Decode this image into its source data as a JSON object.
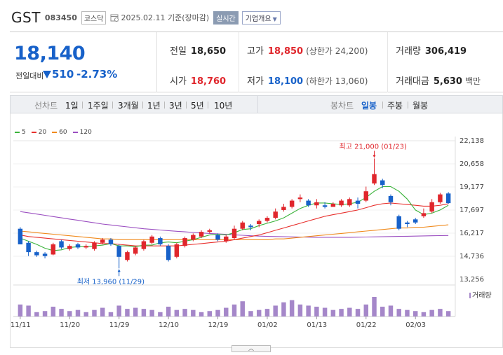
{
  "header": {
    "name": "GST",
    "code": "083450",
    "market": "코스닥",
    "date": "2025.02.11",
    "basis": "기준(장마감)",
    "realtime_label": "실시간",
    "company_label": "기업개요"
  },
  "summary": {
    "current_price": "18,140",
    "change_label": "전일대비",
    "change_value": "510",
    "change_rate": "-2.73%",
    "prev_close_label": "전일",
    "prev_close": "18,650",
    "open_label": "시가",
    "open": "18,760",
    "high_label": "고가",
    "high": "18,850",
    "upper_limit": "(상한가 24,200)",
    "low_label": "저가",
    "low": "18,100",
    "lower_limit": "(하한가 13,060)",
    "volume_label": "거래량",
    "volume": "306,419",
    "amount_label": "거래대금",
    "amount": "5,630",
    "amount_unit": "백만"
  },
  "periodbar": {
    "line_label": "선차트",
    "periods": [
      "1일",
      "1주일",
      "3개월",
      "1년",
      "3년",
      "5년",
      "10년"
    ],
    "candle_label": "봉차트",
    "candles": [
      "일봉",
      "주봉",
      "월봉"
    ],
    "active_candle": "일봉"
  },
  "colors": {
    "up": "#e0262c",
    "down": "#1761c9",
    "ma5": "#3bb33b",
    "ma20": "#e8302d",
    "ma60": "#f08a1c",
    "ma120": "#9b4fc1"
  },
  "chart_data": {
    "type": "candlestick",
    "legend": [
      {
        "name": "5",
        "color": "#3bb33b"
      },
      {
        "name": "20",
        "color": "#e8302d"
      },
      {
        "name": "60",
        "color": "#f08a1c"
      },
      {
        "name": "120",
        "color": "#9b4fc1"
      }
    ],
    "y_ticks": [
      "22,138",
      "20,658",
      "19,177",
      "17,697",
      "16,217",
      "14,736",
      "13,256"
    ],
    "ylim": [
      13256,
      22138
    ],
    "x_ticks": [
      "11/11",
      "11/20",
      "11/29",
      "12/10",
      "12/19",
      "01/02",
      "01/13",
      "01/22",
      "02/03"
    ],
    "x_tick_index": [
      0,
      6,
      12,
      18,
      24,
      30,
      36,
      42,
      48
    ],
    "volume_label": "거래량",
    "annotations": {
      "high": "최고 21,000 (01/23)",
      "low": "최저 13,960 (11/29)"
    },
    "candles": [
      [
        16500,
        15500,
        16600,
        15500
      ],
      [
        15600,
        15000,
        15700,
        14750
      ],
      [
        15000,
        14800,
        15100,
        14700
      ],
      [
        14900,
        14750,
        15000,
        14600
      ],
      [
        14850,
        15500,
        15600,
        14800
      ],
      [
        15700,
        15300,
        15800,
        15200
      ],
      [
        15200,
        15400,
        15500,
        15100
      ],
      [
        15500,
        15300,
        15600,
        15200
      ],
      [
        15300,
        15400,
        15500,
        15200
      ],
      [
        15200,
        15600,
        15700,
        15100
      ],
      [
        15600,
        15800,
        15900,
        15500
      ],
      [
        15800,
        15500,
        15900,
        15400
      ],
      [
        15400,
        14700,
        15500,
        13960
      ],
      [
        14500,
        15000,
        15100,
        14400
      ],
      [
        14900,
        15300,
        15400,
        14800
      ],
      [
        15200,
        15700,
        15800,
        15100
      ],
      [
        15600,
        16000,
        16100,
        15500
      ],
      [
        15900,
        15500,
        16000,
        15400
      ],
      [
        15400,
        14500,
        15500,
        14400
      ],
      [
        14700,
        15500,
        15600,
        14600
      ],
      [
        15400,
        15900,
        16000,
        15300
      ],
      [
        15800,
        16100,
        16200,
        15700
      ],
      [
        16000,
        16300,
        16400,
        15900
      ],
      [
        16300,
        16400,
        16500,
        16200
      ],
      [
        16100,
        15800,
        16200,
        15700
      ],
      [
        15700,
        16000,
        16100,
        15600
      ],
      [
        15900,
        16500,
        16700,
        15800
      ],
      [
        16500,
        16900,
        17000,
        16400
      ],
      [
        16700,
        16600,
        16800,
        16400
      ],
      [
        16800,
        17000,
        17100,
        16600
      ],
      [
        17000,
        17200,
        17300,
        16900
      ],
      [
        17200,
        17600,
        17800,
        17100
      ],
      [
        17700,
        17900,
        18100,
        17600
      ],
      [
        17900,
        18300,
        18400,
        17800
      ],
      [
        18400,
        18500,
        18700,
        18200
      ],
      [
        18300,
        18000,
        18400,
        17900
      ],
      [
        18000,
        18200,
        18400,
        17800
      ],
      [
        18000,
        17900,
        18200,
        17800
      ],
      [
        17900,
        18100,
        18200,
        17900
      ],
      [
        18000,
        18300,
        18400,
        17900
      ],
      [
        18000,
        18400,
        18500,
        17900
      ],
      [
        18300,
        18100,
        18500,
        17800
      ],
      [
        18300,
        18900,
        19200,
        18200
      ],
      [
        19400,
        20000,
        21000,
        19300
      ],
      [
        19600,
        19300,
        19700,
        19100
      ],
      [
        18600,
        18200,
        18700,
        18000
      ],
      [
        17300,
        16500,
        17400,
        16400
      ],
      [
        16900,
        16800,
        17000,
        16600
      ],
      [
        17100,
        16900,
        17200,
        16800
      ],
      [
        17300,
        17500,
        17800,
        17200
      ],
      [
        17600,
        18200,
        18400,
        17500
      ],
      [
        18200,
        18700,
        18800,
        18100
      ],
      [
        18760,
        18140,
        18850,
        18100
      ]
    ],
    "volumes": [
      22,
      20,
      8,
      10,
      18,
      14,
      10,
      12,
      8,
      12,
      16,
      8,
      20,
      14,
      16,
      14,
      12,
      8,
      18,
      12,
      14,
      12,
      8,
      10,
      12,
      16,
      22,
      28,
      10,
      12,
      14,
      20,
      26,
      30,
      22,
      20,
      18,
      16,
      12,
      14,
      16,
      14,
      22,
      36,
      18,
      20,
      14,
      12,
      10,
      8,
      12,
      14,
      10
    ],
    "ma5": [
      15900,
      15700,
      15500,
      15250,
      15100,
      15150,
      15300,
      15350,
      15350,
      15400,
      15450,
      15550,
      15400,
      15400,
      15350,
      15450,
      15450,
      15600,
      15650,
      15600,
      15700,
      15800,
      15950,
      16100,
      16150,
      16100,
      16250,
      16450,
      16500,
      16700,
      16850,
      17000,
      17200,
      17500,
      17800,
      18000,
      18150,
      18150,
      18100,
      18050,
      18100,
      18200,
      18500,
      18900,
      19200,
      19200,
      18900,
      18400,
      17700,
      17400,
      17500,
      17700,
      18000
    ],
    "ma20": [
      16100,
      16000,
      15950,
      15900,
      15850,
      15800,
      15750,
      15700,
      15650,
      15600,
      15550,
      15550,
      15500,
      15450,
      15400,
      15400,
      15400,
      15400,
      15400,
      15400,
      15450,
      15500,
      15550,
      15600,
      15650,
      15700,
      15800,
      15900,
      16000,
      16100,
      16250,
      16400,
      16550,
      16700,
      16850,
      17000,
      17150,
      17300,
      17400,
      17500,
      17600,
      17700,
      17850,
      18000,
      18100,
      18150,
      18100,
      18050,
      18000,
      17950,
      17950,
      18000,
      18100
    ],
    "ma60": [
      16350,
      16300,
      16250,
      16200,
      16150,
      16100,
      16050,
      16000,
      15950,
      15900,
      15850,
      15850,
      15800,
      15800,
      15800,
      15800,
      15800,
      15800,
      15800,
      15800,
      15800,
      15800,
      15800,
      15800,
      15800,
      15800,
      15800,
      15800,
      15800,
      15800,
      15800,
      15850,
      15850,
      15900,
      15950,
      16000,
      16050,
      16100,
      16150,
      16200,
      16250,
      16300,
      16350,
      16400,
      16450,
      16500,
      16550,
      16550,
      16600,
      16600,
      16650,
      16700,
      16750
    ],
    "ma120": [
      17600,
      17520,
      17440,
      17360,
      17280,
      17200,
      17120,
      17040,
      16960,
      16880,
      16800,
      16740,
      16680,
      16620,
      16560,
      16500,
      16460,
      16420,
      16380,
      16340,
      16300,
      16260,
      16230,
      16200,
      16170,
      16140,
      16110,
      16080,
      16050,
      16030,
      16010,
      16000,
      15990,
      15980,
      15970,
      15960,
      15950,
      15950,
      15950,
      15950,
      15950,
      15960,
      15970,
      15980,
      15990,
      16000,
      16010,
      16020,
      16030,
      16040,
      16050,
      16060,
      16070
    ]
  }
}
